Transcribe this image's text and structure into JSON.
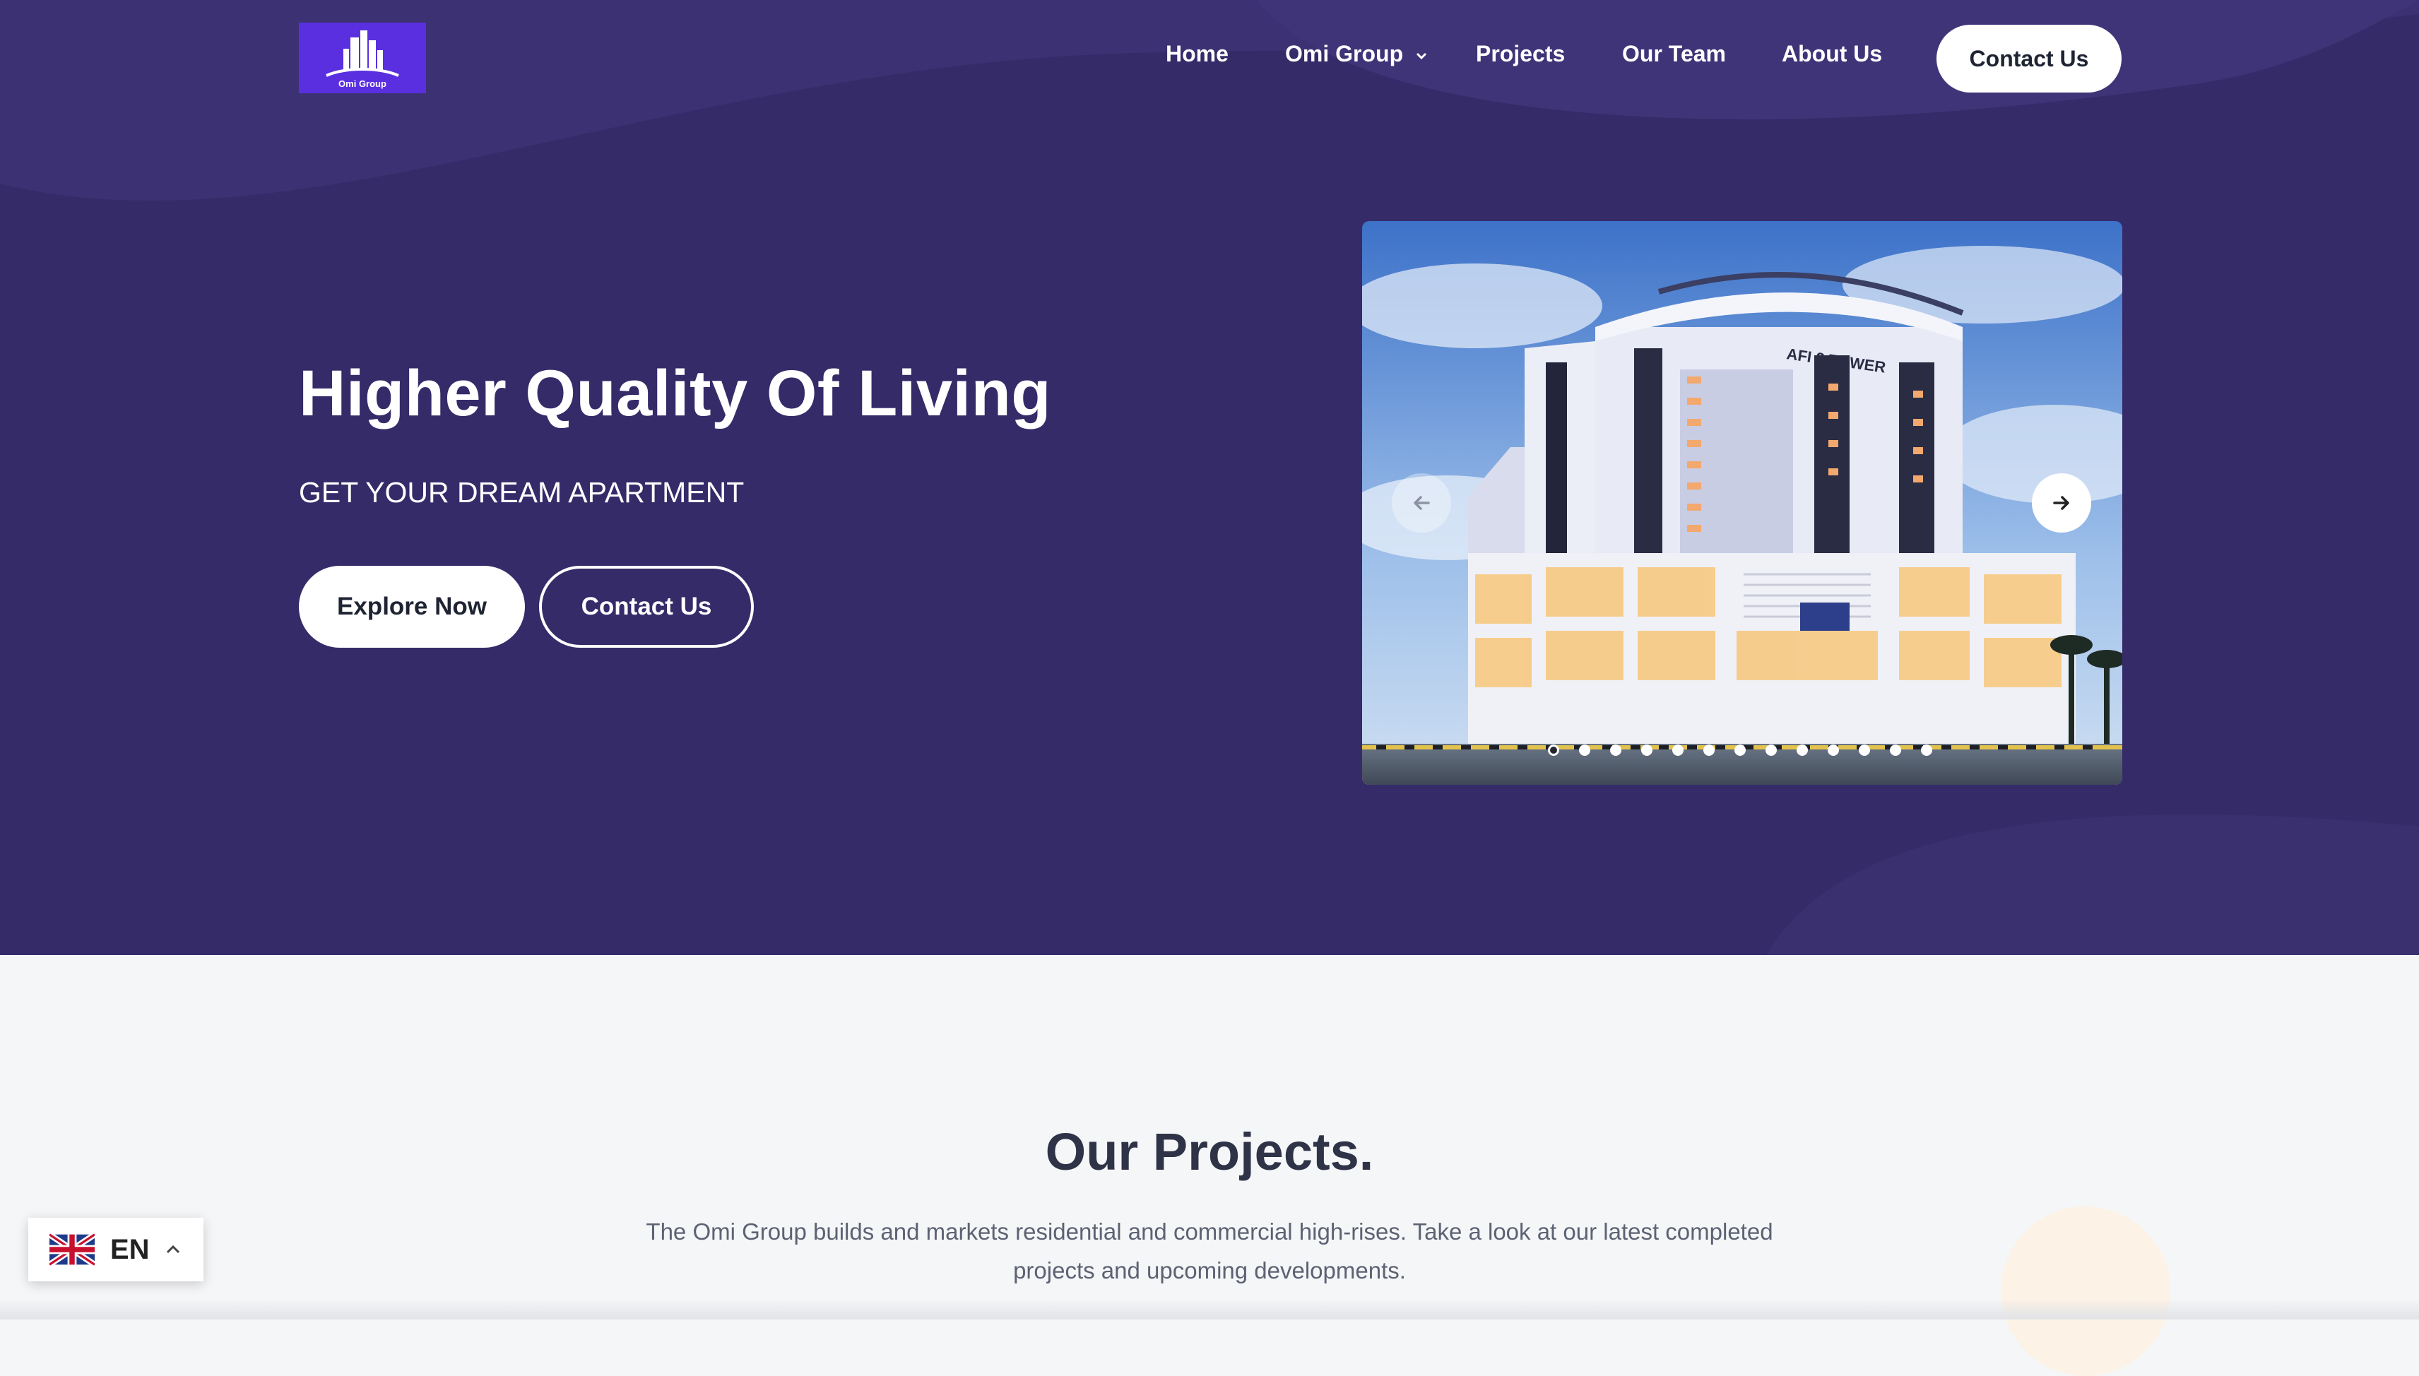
{
  "brand": {
    "logo_text": "Omi Group"
  },
  "nav": {
    "items": [
      {
        "label": "Home"
      },
      {
        "label": "Omi Group",
        "has_dropdown": true
      },
      {
        "label": "Projects"
      },
      {
        "label": "Our Team"
      },
      {
        "label": "About Us"
      }
    ],
    "contact_label": "Contact Us"
  },
  "hero": {
    "headline": "Higher Quality Of Living",
    "subheadline": "GET YOUR DREAM APARTMENT",
    "explore_label": "Explore Now",
    "contact_label": "Contact Us",
    "slider": {
      "building_sign": "AFI 2 TOWER",
      "slide_count": 13,
      "active_slide": 1
    }
  },
  "projects": {
    "title": "Our Projects.",
    "description": "The Omi Group builds and markets residential and commercial high-rises. Take a look at our latest completed projects and upcoming developments."
  },
  "language": {
    "code": "EN",
    "flag": "uk-flag-icon"
  },
  "colors": {
    "hero_bg": "#352b69",
    "logo_bg": "#5a2fe0",
    "section_bg": "#f5f6f8",
    "title_color": "#2e3347"
  }
}
